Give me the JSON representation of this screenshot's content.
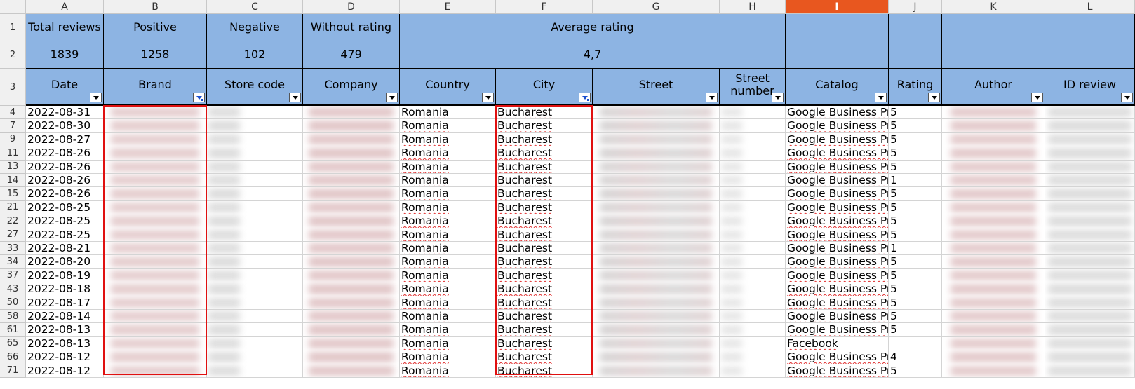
{
  "columns": [
    "A",
    "B",
    "C",
    "D",
    "E",
    "F",
    "G",
    "H",
    "I",
    "J",
    "K",
    "L"
  ],
  "selected_column": "I",
  "summary_headers": {
    "total_reviews": "Total reviews",
    "positive": "Positive",
    "negative": "Negative",
    "without_rating": "Without rating",
    "average_rating": "Average rating"
  },
  "summary_values": {
    "total_reviews": "1839",
    "positive": "1258",
    "negative": "102",
    "without_rating": "479",
    "average_rating": "4,7"
  },
  "header_row_numbers": [
    "1",
    "2",
    "3"
  ],
  "table_headers": [
    "Date",
    "Brand",
    "Store code",
    "Company",
    "Country",
    "City",
    "Street",
    "Street number",
    "Catalog",
    "Rating",
    "Author",
    "ID review"
  ],
  "active_filters": [
    "Brand",
    "City"
  ],
  "rows": [
    {
      "row": "4",
      "date": "2022-08-31",
      "country": "Romania",
      "city": "Bucharest",
      "catalog": "Google Business Pr",
      "rating": "5"
    },
    {
      "row": "7",
      "date": "2022-08-30",
      "country": "Romania",
      "city": "Bucharest",
      "catalog": "Google Business Pr",
      "rating": "5"
    },
    {
      "row": "9",
      "date": "2022-08-27",
      "country": "Romania",
      "city": "Bucharest",
      "catalog": "Google Business Pr",
      "rating": "5"
    },
    {
      "row": "11",
      "date": "2022-08-26",
      "country": "Romania",
      "city": "Bucharest",
      "catalog": "Google Business Pr",
      "rating": "5"
    },
    {
      "row": "13",
      "date": "2022-08-26",
      "country": "Romania",
      "city": "Bucharest",
      "catalog": "Google Business Pr",
      "rating": "5"
    },
    {
      "row": "14",
      "date": "2022-08-26",
      "country": "Romania",
      "city": "Bucharest",
      "catalog": "Google Business Pr",
      "rating": "1"
    },
    {
      "row": "15",
      "date": "2022-08-26",
      "country": "Romania",
      "city": "Bucharest",
      "catalog": "Google Business Pr",
      "rating": "5"
    },
    {
      "row": "21",
      "date": "2022-08-25",
      "country": "Romania",
      "city": "Bucharest",
      "catalog": "Google Business Pr",
      "rating": "5"
    },
    {
      "row": "22",
      "date": "2022-08-25",
      "country": "Romania",
      "city": "Bucharest",
      "catalog": "Google Business Pr",
      "rating": "5"
    },
    {
      "row": "27",
      "date": "2022-08-25",
      "country": "Romania",
      "city": "Bucharest",
      "catalog": "Google Business Pr",
      "rating": "5"
    },
    {
      "row": "33",
      "date": "2022-08-21",
      "country": "Romania",
      "city": "Bucharest",
      "catalog": "Google Business Pr",
      "rating": "1"
    },
    {
      "row": "34",
      "date": "2022-08-20",
      "country": "Romania",
      "city": "Bucharest",
      "catalog": "Google Business Pr",
      "rating": "5"
    },
    {
      "row": "37",
      "date": "2022-08-19",
      "country": "Romania",
      "city": "Bucharest",
      "catalog": "Google Business Pr",
      "rating": "5"
    },
    {
      "row": "43",
      "date": "2022-08-18",
      "country": "Romania",
      "city": "Bucharest",
      "catalog": "Google Business Pr",
      "rating": "5"
    },
    {
      "row": "50",
      "date": "2022-08-17",
      "country": "Romania",
      "city": "Bucharest",
      "catalog": "Google Business Pr",
      "rating": "5"
    },
    {
      "row": "58",
      "date": "2022-08-14",
      "country": "Romania",
      "city": "Bucharest",
      "catalog": "Google Business Pr",
      "rating": "5"
    },
    {
      "row": "61",
      "date": "2022-08-13",
      "country": "Romania",
      "city": "Bucharest",
      "catalog": "Google Business Pr",
      "rating": "5"
    },
    {
      "row": "65",
      "date": "2022-08-13",
      "country": "Romania",
      "city": "Bucharest",
      "catalog": "Facebook",
      "rating": ""
    },
    {
      "row": "66",
      "date": "2022-08-12",
      "country": "Romania",
      "city": "Bucharest",
      "catalog": "Google Business Pr",
      "rating": "4"
    },
    {
      "row": "71",
      "date": "2022-08-12",
      "country": "Romania",
      "city": "Bucharest",
      "catalog": "Google Business Pr",
      "rating": "5"
    }
  ],
  "colors": {
    "header_fill": "#8db4e3",
    "selected_column": "#e8571f",
    "highlight_border": "#e01010",
    "spellcheck": "#e03030",
    "filter_active": "#1a4fcf"
  }
}
